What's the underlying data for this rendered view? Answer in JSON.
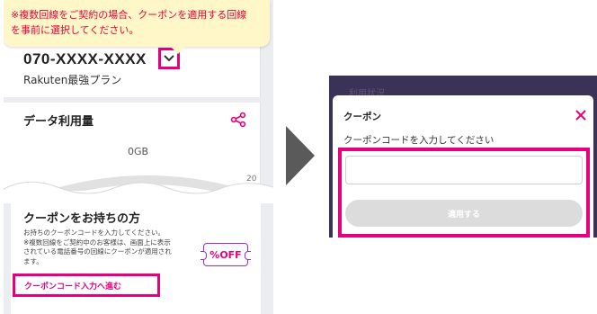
{
  "left_screen": {
    "tooltip_lines": [
      "※複数回線をご契約の場合、クーポンを適用する回線",
      "を事前に選択してください。"
    ],
    "phone_number": "070-XXXX-XXXX",
    "plan_name": "Rakuten最強プラン",
    "data_usage_title": "データ利用量",
    "data_usage_value": "0GB",
    "gauge_partial_number": "20",
    "coupon_section_title": "クーポンをお持ちの方",
    "coupon_description_lines": [
      "お持ちのクーポンコードを入力してください。",
      "※複数回線をご契約中のお客様は、画面上に表示",
      "されている電話番号の回線にクーポンが適用され",
      "ます。"
    ],
    "off_badge": "%OFF",
    "coupon_link": "クーポンコード入力へ進む"
  },
  "right_screen": {
    "behind_text": "利用状況",
    "modal_title": "クーポン",
    "input_label": "クーポンコードを入力してください",
    "input_value": "",
    "apply_button": "適用する"
  },
  "colors": {
    "highlight": "#e6007e",
    "tooltip_bg": "#fff7c7",
    "tooltip_text": "#e8003a",
    "modal_backdrop": "#3b3357",
    "arrow": "#5a5a5a"
  },
  "icons": [
    "chevron-down-icon",
    "share-icon",
    "close-icon",
    "arrow-right-icon"
  ]
}
